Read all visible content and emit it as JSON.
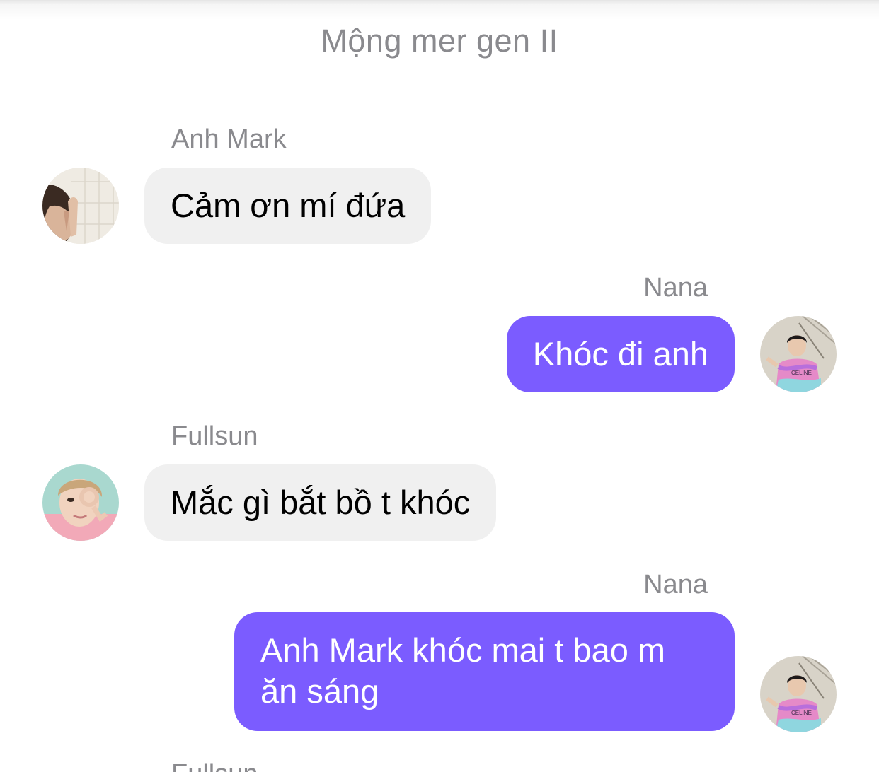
{
  "chat": {
    "title": "Mộng mer gen II"
  },
  "messages": [
    {
      "sender": "Anh Mark",
      "text": "Cảm ơn mí đứa",
      "direction": "incoming",
      "avatar": "avatar-anh-mark"
    },
    {
      "sender": "Nana",
      "text": "Khóc đi anh",
      "direction": "outgoing",
      "avatar": "avatar-nana"
    },
    {
      "sender": "Fullsun",
      "text": "Mắc gì bắt bồ t khóc",
      "direction": "incoming",
      "avatar": "avatar-fullsun"
    },
    {
      "sender": "Nana",
      "text": "Anh Mark khóc mai t bao m ăn sáng",
      "direction": "outgoing",
      "avatar": "avatar-nana"
    }
  ],
  "colors": {
    "outgoing_bubble": "#7b5cff",
    "incoming_bubble": "#f0f0f0",
    "name_text": "#8a8a8e"
  }
}
